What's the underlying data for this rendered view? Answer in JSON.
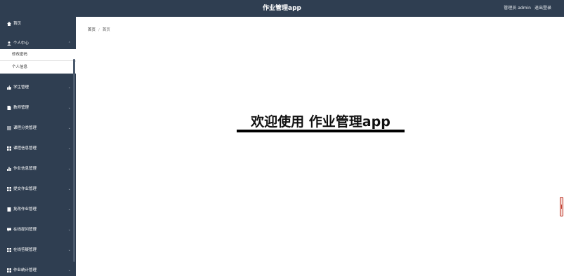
{
  "header": {
    "title": "作业管理app",
    "user": "管理员 admin",
    "logout": "退出登录"
  },
  "sidebar": {
    "home": {
      "label": "首页",
      "icon": "home-icon"
    },
    "personal": {
      "label": "个人中心",
      "icon": "user-icon",
      "children": [
        "修改密码",
        "个人信息"
      ]
    },
    "items": [
      {
        "label": "学生管理",
        "icon": "thumb-icon"
      },
      {
        "label": "教师管理",
        "icon": "file-icon"
      },
      {
        "label": "课程分类管理",
        "icon": "list-icon"
      },
      {
        "label": "课程信息管理",
        "icon": "grid-icon"
      },
      {
        "label": "作业信息管理",
        "icon": "bar-chart-icon"
      },
      {
        "label": "提交作业管理",
        "icon": "grid-icon"
      },
      {
        "label": "批改作业管理",
        "icon": "file-icon"
      },
      {
        "label": "在线提问管理",
        "icon": "chat-icon"
      },
      {
        "label": "在线答疑管理",
        "icon": "grid-icon"
      },
      {
        "label": "作业统计管理",
        "icon": "grid-icon"
      }
    ]
  },
  "breadcrumb": {
    "root": "首页",
    "current": "首页"
  },
  "welcome": "欢迎使用 作业管理app",
  "colors": {
    "sidebar": "#2f3e51",
    "header": "#2f3e51",
    "text": "#111111"
  }
}
